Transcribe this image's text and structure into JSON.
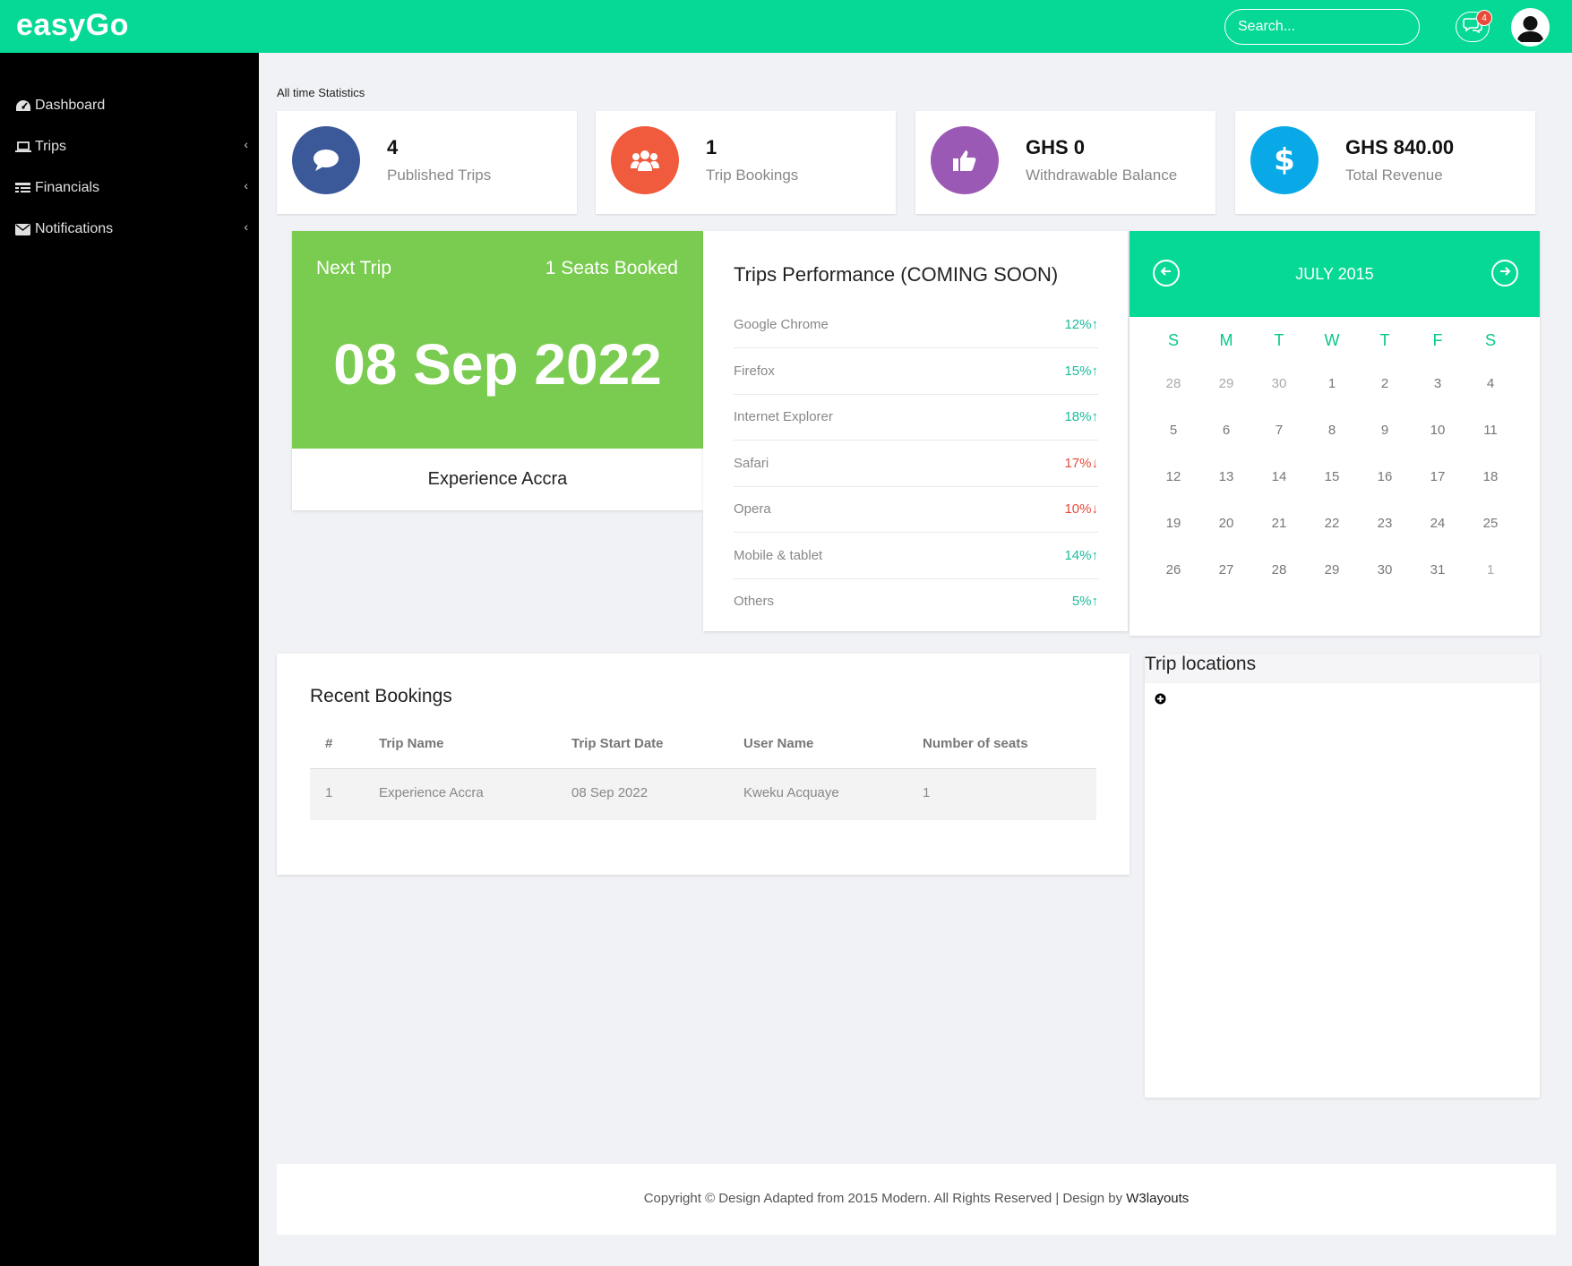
{
  "app": {
    "logo": "easyGo"
  },
  "header": {
    "search_placeholder": "Search...",
    "notification_count": "4"
  },
  "sidebar": {
    "items": [
      {
        "label": "Dashboard",
        "icon": "dashboard-icon"
      },
      {
        "label": "Trips",
        "icon": "laptop-icon",
        "has_submenu": true
      },
      {
        "label": "Financials",
        "icon": "list-icon",
        "has_submenu": true
      },
      {
        "label": "Notifications",
        "icon": "envelope-icon",
        "has_submenu": true
      }
    ]
  },
  "stats": {
    "title": "All time Statistics",
    "cards": [
      {
        "value": "4",
        "label": "Published Trips",
        "color": "#3b5998",
        "icon": "comment-icon"
      },
      {
        "value": "1",
        "label": "Trip Bookings",
        "color": "#f05a3d",
        "icon": "users-icon"
      },
      {
        "value": "GHS 0",
        "label": "Withdrawable Balance",
        "color": "#9b59b6",
        "icon": "thumbs-up-icon"
      },
      {
        "value": "GHS 840.00",
        "label": "Total Revenue",
        "color": "#09a9e8",
        "icon": "dollar-icon"
      }
    ]
  },
  "next_trip": {
    "label": "Next Trip",
    "seats": "1 Seats Booked",
    "date": "08 Sep 2022",
    "name": "Experience Accra",
    "color": "#7acc50"
  },
  "performance": {
    "title": "Trips Performance (COMING SOON)",
    "rows": [
      {
        "name": "Google Chrome",
        "value": "12%",
        "trend": "up"
      },
      {
        "name": "Firefox",
        "value": "15%",
        "trend": "up"
      },
      {
        "name": "Internet Explorer",
        "value": "18%",
        "trend": "up"
      },
      {
        "name": "Safari",
        "value": "17%",
        "trend": "down"
      },
      {
        "name": "Opera",
        "value": "10%",
        "trend": "down"
      },
      {
        "name": "Mobile & tablet",
        "value": "14%",
        "trend": "up"
      },
      {
        "name": "Others",
        "value": "5%",
        "trend": "up"
      }
    ],
    "up_color": "#1abc9c",
    "down_color": "#e74c3c"
  },
  "calendar": {
    "month": "JULY 2015",
    "weekdays": [
      "S",
      "M",
      "T",
      "W",
      "T",
      "F",
      "S"
    ],
    "weeks": [
      [
        "28",
        "29",
        "30",
        "1",
        "2",
        "3",
        "4"
      ],
      [
        "5",
        "6",
        "7",
        "8",
        "9",
        "10",
        "11"
      ],
      [
        "12",
        "13",
        "14",
        "15",
        "16",
        "17",
        "18"
      ],
      [
        "19",
        "20",
        "21",
        "22",
        "23",
        "24",
        "25"
      ],
      [
        "26",
        "27",
        "28",
        "29",
        "30",
        "31",
        "1"
      ]
    ],
    "muted": [
      [
        0,
        0
      ],
      [
        0,
        1
      ],
      [
        0,
        2
      ],
      [
        4,
        6
      ]
    ]
  },
  "bookings": {
    "title": "Recent Bookings",
    "columns": [
      "#",
      "Trip Name",
      "Trip Start Date",
      "User Name",
      "Number of seats"
    ],
    "rows": [
      [
        "1",
        "Experience Accra",
        "08 Sep 2022",
        "Kweku Acquaye",
        "1"
      ]
    ]
  },
  "locations": {
    "title": "Trip locations"
  },
  "footer": {
    "text": "Copyright © Design Adapted from 2015 Modern. All Rights Reserved | Design by ",
    "link": "W3layouts"
  },
  "colors": {
    "brand": "#06d995",
    "sidebar": "#000000"
  }
}
